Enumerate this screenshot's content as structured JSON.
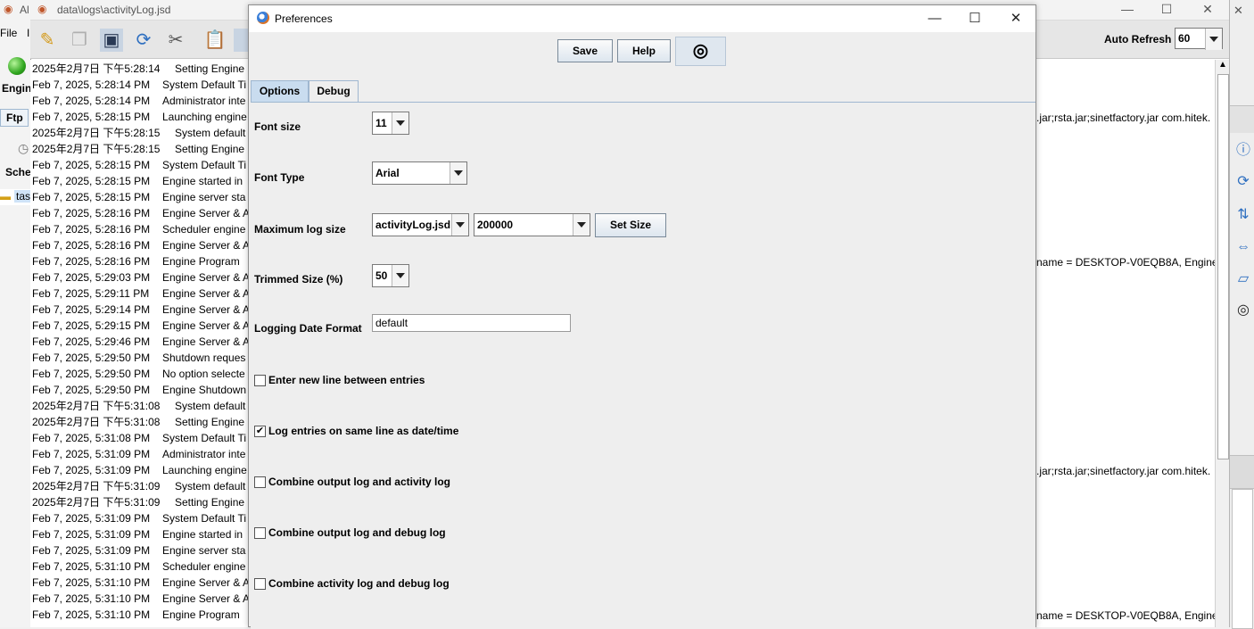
{
  "log_window": {
    "title": "data\\logs\\activityLog.jsd",
    "auto_refresh_label": "Auto Refresh",
    "auto_refresh_value": "60",
    "left_pane": {
      "app_title_fragment": "Al",
      "menu_file": "File",
      "menu_second": "I",
      "engine_label": "Engin",
      "ftp_tab": "Ftp",
      "sche_label": "Sche",
      "tree_item": "tas"
    },
    "log_rows": [
      {
        "date": "2025年2月7日 下午5:28:14",
        "msg": "Setting Engine"
      },
      {
        "date": "Feb 7, 2025, 5:28:14 PM",
        "msg": "System Default Ti"
      },
      {
        "date": "Feb 7, 2025, 5:28:14 PM",
        "msg": "Administrator inte"
      },
      {
        "date": "Feb 7, 2025, 5:28:15 PM",
        "msg": "Launching engine"
      },
      {
        "date": "2025年2月7日 下午5:28:15",
        "msg": "System default"
      },
      {
        "date": "2025年2月7日 下午5:28:15",
        "msg": "Setting Engine"
      },
      {
        "date": "Feb 7, 2025, 5:28:15 PM",
        "msg": "System Default Ti"
      },
      {
        "date": "Feb 7, 2025, 5:28:15 PM",
        "msg": "Engine started in"
      },
      {
        "date": "Feb 7, 2025, 5:28:15 PM",
        "msg": "Engine server sta"
      },
      {
        "date": "Feb 7, 2025, 5:28:16 PM",
        "msg": "Engine Server & A"
      },
      {
        "date": "Feb 7, 2025, 5:28:16 PM",
        "msg": "Scheduler engine"
      },
      {
        "date": "Feb 7, 2025, 5:28:16 PM",
        "msg": "Engine Server & A"
      },
      {
        "date": "Feb 7, 2025, 5:28:16 PM",
        "msg": "Engine Program"
      },
      {
        "date": "Feb 7, 2025, 5:29:03 PM",
        "msg": "Engine Server & A"
      },
      {
        "date": "Feb 7, 2025, 5:29:11 PM",
        "msg": "Engine Server & A"
      },
      {
        "date": "Feb 7, 2025, 5:29:14 PM",
        "msg": "Engine Server & A"
      },
      {
        "date": "Feb 7, 2025, 5:29:15 PM",
        "msg": "Engine Server & A"
      },
      {
        "date": "Feb 7, 2025, 5:29:46 PM",
        "msg": "Engine Server & A"
      },
      {
        "date": "Feb 7, 2025, 5:29:50 PM",
        "msg": "Shutdown reques"
      },
      {
        "date": "Feb 7, 2025, 5:29:50 PM",
        "msg": "No option selecte"
      },
      {
        "date": "Feb 7, 2025, 5:29:50 PM",
        "msg": "Engine Shutdown"
      },
      {
        "date": "2025年2月7日 下午5:31:08",
        "msg": "System default"
      },
      {
        "date": "2025年2月7日 下午5:31:08",
        "msg": "Setting Engine"
      },
      {
        "date": "Feb 7, 2025, 5:31:08 PM",
        "msg": "System Default Ti"
      },
      {
        "date": "Feb 7, 2025, 5:31:09 PM",
        "msg": "Administrator inte"
      },
      {
        "date": "Feb 7, 2025, 5:31:09 PM",
        "msg": "Launching engine"
      },
      {
        "date": "2025年2月7日 下午5:31:09",
        "msg": "System default"
      },
      {
        "date": "2025年2月7日 下午5:31:09",
        "msg": "Setting Engine"
      },
      {
        "date": "Feb 7, 2025, 5:31:09 PM",
        "msg": "System Default Ti"
      },
      {
        "date": "Feb 7, 2025, 5:31:09 PM",
        "msg": "Engine started in"
      },
      {
        "date": "Feb 7, 2025, 5:31:09 PM",
        "msg": "Engine server sta"
      },
      {
        "date": "Feb 7, 2025, 5:31:10 PM",
        "msg": "Scheduler engine"
      },
      {
        "date": "Feb 7, 2025, 5:31:10 PM",
        "msg": "Engine Server & A"
      },
      {
        "date": "Feb 7, 2025, 5:31:10 PM",
        "msg": "Engine Server & A"
      },
      {
        "date": "Feb 7, 2025, 5:31:10 PM",
        "msg": "Engine Program"
      }
    ],
    "right_fragments": [
      {
        "row": 3,
        "text": ".jar;rsta.jar;sinetfactory.jar com.hitek."
      },
      {
        "row": 12,
        "text": "name  = DESKTOP-V0EQB8A, Engine"
      },
      {
        "row": 25,
        "text": ".jar;rsta.jar;sinetfactory.jar com.hitek."
      },
      {
        "row": 34,
        "text": "name  = DESKTOP-V0EQB8A, Engine"
      }
    ]
  },
  "dialog": {
    "title": "Preferences",
    "buttons": {
      "save": "Save",
      "help": "Help"
    },
    "tabs": {
      "options": "Options",
      "debug": "Debug"
    },
    "options": {
      "font_size_label": "Font size",
      "font_size_value": "11",
      "font_type_label": "Font Type",
      "font_type_value": "Arial",
      "max_log_size_label": "Maximum log size",
      "max_log_file_value": "activityLog.jsd",
      "max_log_size_value": "200000",
      "set_size_button": "Set Size",
      "trimmed_size_label": "Trimmed Size (%)",
      "trimmed_size_value": "50",
      "date_format_label": "Logging Date Format",
      "date_format_value": "default",
      "checkboxes": [
        {
          "label": "Enter new line between entries",
          "checked": false
        },
        {
          "label": "Log entries on same line as date/time",
          "checked": true
        },
        {
          "label": "Combine output log and activity log",
          "checked": false
        },
        {
          "label": "Combine output log and debug log",
          "checked": false
        },
        {
          "label": "Combine activity log and debug log",
          "checked": false
        }
      ]
    }
  },
  "colors": {
    "accent": "#3b7fd8",
    "tab_border": "#9fb7d0"
  }
}
